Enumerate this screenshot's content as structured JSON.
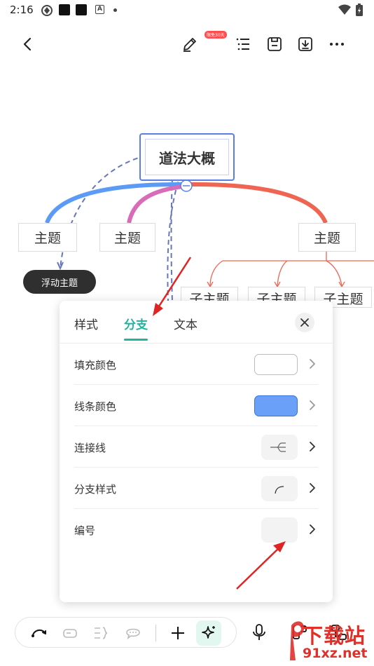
{
  "status_bar": {
    "time": "2:16"
  },
  "toolbar": {
    "promo_badge": "限免30天",
    "icons": [
      "back-icon",
      "pen-icon",
      "outline-icon",
      "save-icon",
      "download-icon",
      "more-icon"
    ]
  },
  "mindmap": {
    "root": "道法大概",
    "topics": [
      "主题",
      "主题",
      "主题"
    ],
    "floating_topic": "浮动主题",
    "subtopics": [
      "子主题",
      "子主题",
      "子主题"
    ]
  },
  "sheet": {
    "tabs": [
      {
        "label": "样式"
      },
      {
        "label": "分支"
      },
      {
        "label": "文本"
      }
    ],
    "active_tab": "分支",
    "rows": [
      {
        "label": "填充颜色",
        "swatch": "#ffffff"
      },
      {
        "label": "线条颜色",
        "swatch": "#6aa0f8"
      },
      {
        "label": "连接线"
      },
      {
        "label": "分支样式"
      },
      {
        "label": "编号"
      }
    ]
  },
  "colors": {
    "accent": "#1fb5a0",
    "branch_blue": "#5b9bf5",
    "branch_pink": "#d96cb8",
    "branch_red": "#ef6552",
    "annotation_red": "#e02424"
  },
  "bottom_toolbar": {
    "icons": [
      "undo-icon",
      "topic-icon",
      "summary-icon",
      "comment-icon",
      "add-icon",
      "ai-sparkle-icon",
      "microphone-icon",
      "layout-icon",
      "structure-icon"
    ]
  },
  "watermark": {
    "text": "下载站",
    "url": "91xz.net"
  }
}
